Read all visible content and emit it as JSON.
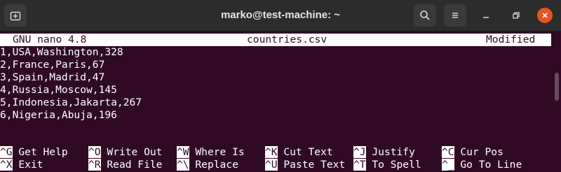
{
  "window": {
    "title": "marko@test-machine: ~",
    "new_tab_icon": "new-tab-icon",
    "search_icon": "search-icon",
    "menu_icon": "hamburger-menu-icon",
    "close_color": "#e95420"
  },
  "nano": {
    "version": "GNU nano 4.8",
    "filename": "countries.csv",
    "status": "Modified",
    "lines": [
      "1,USA,Washington,328",
      "2,France,Paris,67",
      "3,Spain,Madrid,47",
      "4,Russia,Moscow,145",
      "5,Indonesia,Jakarta,267",
      "6,Nigeria,Abuja,196"
    ],
    "shortcuts_row1": [
      {
        "key": "^G",
        "label": "Get Help"
      },
      {
        "key": "^O",
        "label": "Write Out"
      },
      {
        "key": "^W",
        "label": "Where Is"
      },
      {
        "key": "^K",
        "label": "Cut Text"
      },
      {
        "key": "^J",
        "label": "Justify"
      },
      {
        "key": "^C",
        "label": "Cur Pos"
      }
    ],
    "shortcuts_row2": [
      {
        "key": "^X",
        "label": "Exit"
      },
      {
        "key": "^R",
        "label": "Read File"
      },
      {
        "key": "^\\",
        "label": "Replace"
      },
      {
        "key": "^U",
        "label": "Paste Text"
      },
      {
        "key": "^T",
        "label": "To Spell"
      },
      {
        "key": "^_",
        "label": "Go To Line"
      }
    ]
  },
  "colors": {
    "terminal_bg": "#300a24",
    "titlebar_bg": "#2c2c2c"
  }
}
